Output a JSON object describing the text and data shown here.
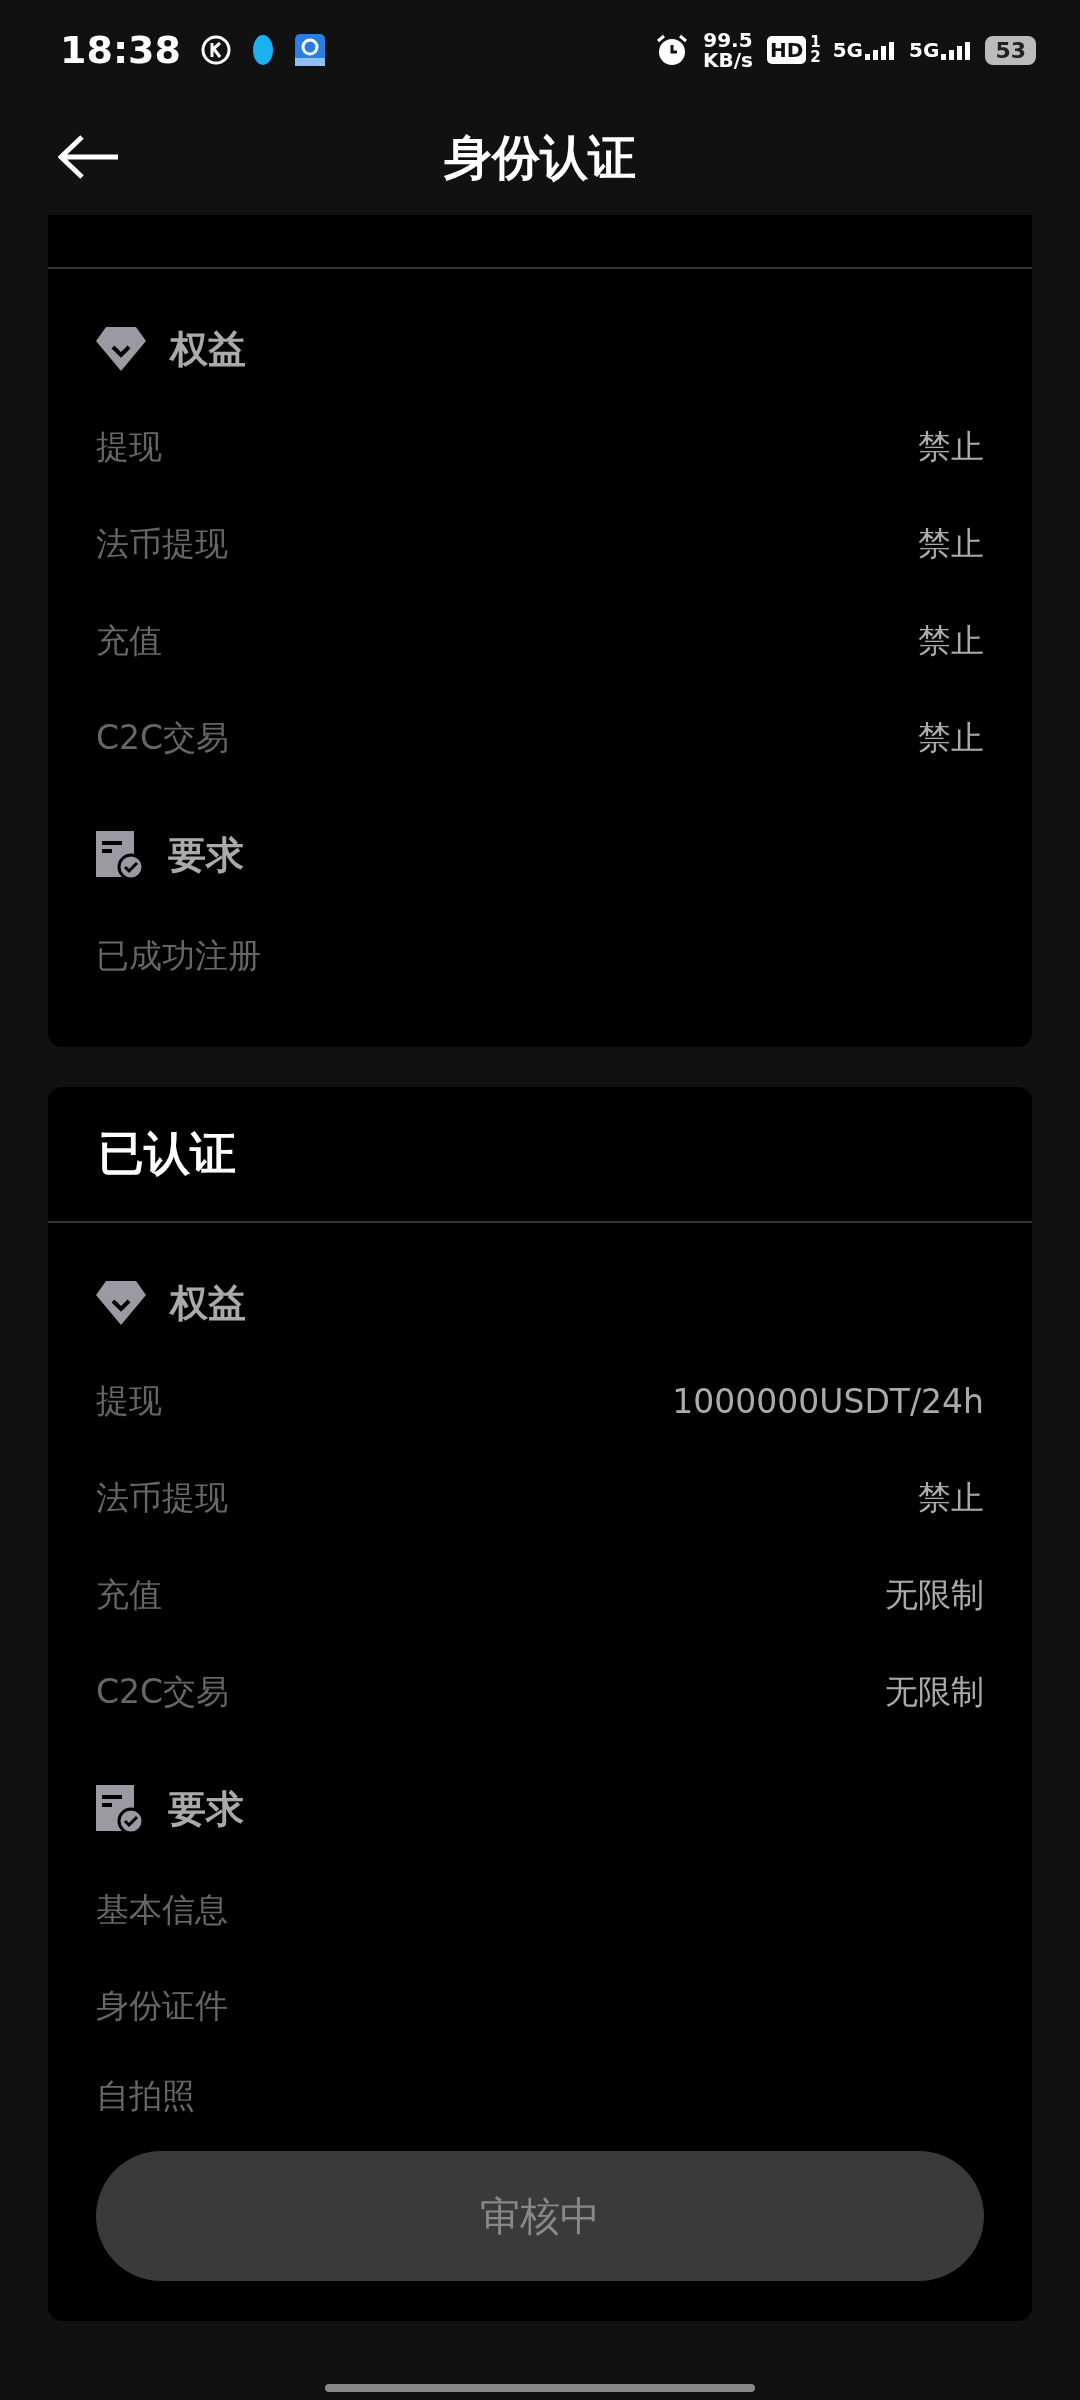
{
  "status_bar": {
    "time": "18:38",
    "speed_value": "99.5",
    "speed_unit": "KB/s",
    "hd": "HD",
    "sims": [
      "1",
      "2"
    ],
    "networks": [
      "5G",
      "5G"
    ],
    "battery": "53"
  },
  "header": {
    "title": "身份认证"
  },
  "levels": [
    {
      "sections": [
        {
          "kind": "benefits",
          "title": "权益",
          "rows": [
            {
              "label": "提现",
              "value": "禁止"
            },
            {
              "label": "法币提现",
              "value": "禁止"
            },
            {
              "label": "充值",
              "value": "禁止"
            },
            {
              "label": "C2C交易",
              "value": "禁止"
            }
          ]
        },
        {
          "kind": "requirements",
          "title": "要求",
          "items": [
            "已成功注册"
          ]
        }
      ]
    },
    {
      "title": "已认证",
      "sections": [
        {
          "kind": "benefits",
          "title": "权益",
          "rows": [
            {
              "label": "提现",
              "value": "1000000USDT/24h"
            },
            {
              "label": "法币提现",
              "value": "禁止"
            },
            {
              "label": "充值",
              "value": "无限制"
            },
            {
              "label": "C2C交易",
              "value": "无限制"
            }
          ]
        },
        {
          "kind": "requirements",
          "title": "要求",
          "items": [
            "基本信息",
            "身份证件",
            "自拍照"
          ]
        }
      ],
      "button": {
        "label": "审核中",
        "disabled": true
      }
    }
  ]
}
